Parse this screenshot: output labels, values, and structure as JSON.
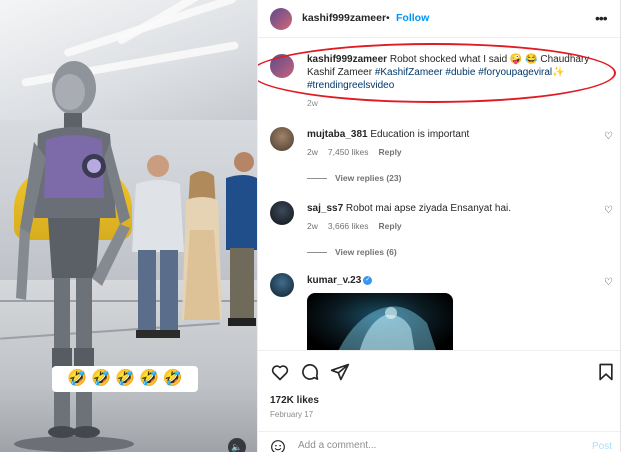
{
  "post": {
    "username": "kashif999zameer",
    "separator": "•",
    "follow_label": "Follow",
    "more_label": "•••"
  },
  "video": {
    "emoji_overlay": [
      "🤣",
      "🤣",
      "🤣",
      "🤣",
      "🤣"
    ],
    "mute_icon": "🔈"
  },
  "caption": {
    "username": "kashif999zameer",
    "text_before": " Robot shocked what I said 🤪 😂 Chaudhary Kashif Zameer ",
    "hashtags": [
      "#KashifZameer",
      "#dubie",
      "#foryoupageviral"
    ],
    "sparkle": "✨",
    "hashtag_last": "#trendingreelsvideo",
    "time": "2w"
  },
  "comments": [
    {
      "username": "mujtaba_381",
      "text": " Education is important",
      "time": "2w",
      "likes": "7,450 likes",
      "reply_label": "Reply",
      "view_replies": "View replies (23)"
    },
    {
      "username": "saj_ss7",
      "text": " Robot mai apse ziyada Ensanyat hai.",
      "time": "2w",
      "likes": "3,666 likes",
      "reply_label": "Reply",
      "view_replies": "View replies (6)"
    },
    {
      "username": "kumar_v.23",
      "verified_mark": "✓"
    }
  ],
  "actions": {
    "likes": "172K likes",
    "date": "February 17",
    "placeholder": "Add a comment...",
    "post_label": "Post",
    "heart_icon": "♡"
  },
  "colors": {
    "link_blue": "#0095f6",
    "hashtag": "#00376b",
    "highlight_red": "#e11b22",
    "muted_text": "#737373"
  },
  "icons": [
    "heart-icon",
    "comment-icon",
    "share-icon",
    "bookmark-icon",
    "emoji-icon",
    "more-options-icon",
    "mute-icon",
    "verified-icon"
  ]
}
